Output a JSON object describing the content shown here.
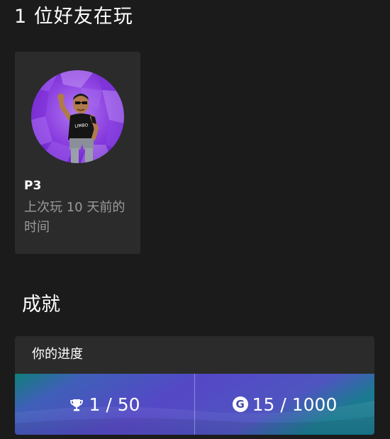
{
  "friends": {
    "title": "1 位好友在玩",
    "items": [
      {
        "name": "P3",
        "last_played": "上次玩 10 天前的时间",
        "avatar_shirt_text": "LIMBO"
      }
    ]
  },
  "achievements": {
    "title": "成就",
    "progress_header": "你的进度",
    "achievements_count": "1 / 50",
    "gamerscore": "15 / 1000",
    "gamerscore_icon_letter": "G",
    "trophy_icon": "trophy-icon",
    "accent_colors": [
      "#0f7f7a",
      "#5a4cc7",
      "#1a6f8f"
    ]
  }
}
